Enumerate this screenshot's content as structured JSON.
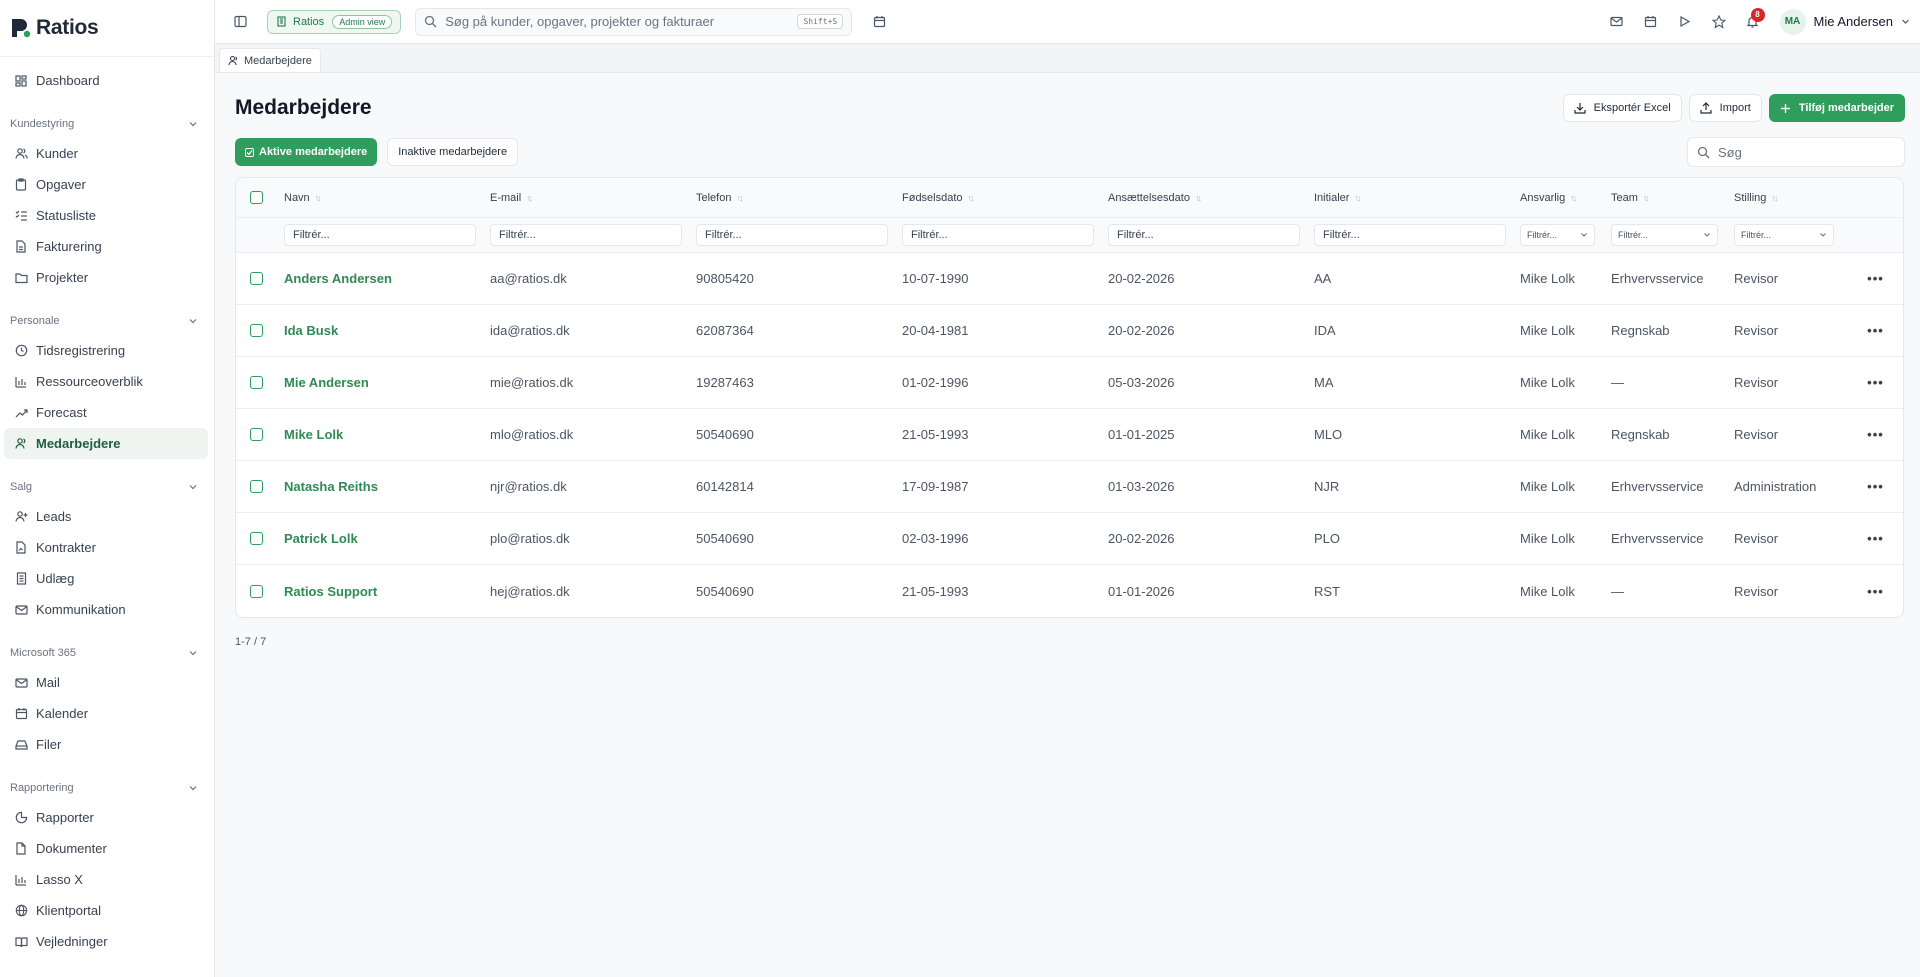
{
  "brand": {
    "name": "Ratios",
    "color": "#2f9e5c"
  },
  "sidebar": {
    "top": [
      {
        "label": "Dashboard",
        "icon": "dashboard-icon"
      }
    ],
    "sections": [
      {
        "title": "Kundestyring",
        "items": [
          {
            "label": "Kunder",
            "icon": "users-icon"
          },
          {
            "label": "Opgaver",
            "icon": "clipboard-icon"
          },
          {
            "label": "Statusliste",
            "icon": "list-check-icon"
          },
          {
            "label": "Fakturering",
            "icon": "file-text-icon"
          },
          {
            "label": "Projekter",
            "icon": "folder-icon"
          }
        ]
      },
      {
        "title": "Personale",
        "items": [
          {
            "label": "Tidsregistrering",
            "icon": "clock-icon"
          },
          {
            "label": "Ressourceoverblik",
            "icon": "bar-chart-icon"
          },
          {
            "label": "Forecast",
            "icon": "trending-up-icon"
          },
          {
            "label": "Medarbejdere",
            "icon": "user-icon",
            "active": true
          }
        ]
      },
      {
        "title": "Salg",
        "items": [
          {
            "label": "Leads",
            "icon": "user-plus-icon"
          },
          {
            "label": "Kontrakter",
            "icon": "file-signature-icon"
          },
          {
            "label": "Udlæg",
            "icon": "receipt-icon"
          },
          {
            "label": "Kommunikation",
            "icon": "mail-icon"
          }
        ]
      },
      {
        "title": "Microsoft 365",
        "items": [
          {
            "label": "Mail",
            "icon": "mail-icon"
          },
          {
            "label": "Kalender",
            "icon": "calendar-icon"
          },
          {
            "label": "Filer",
            "icon": "hard-drive-icon"
          }
        ]
      },
      {
        "title": "Rapportering",
        "items": [
          {
            "label": "Rapporter",
            "icon": "pie-chart-icon"
          },
          {
            "label": "Dokumenter",
            "icon": "file-icon"
          },
          {
            "label": "Lasso X",
            "icon": "bar-chart-icon"
          },
          {
            "label": "Klientportal",
            "icon": "globe-icon"
          },
          {
            "label": "Vejledninger",
            "icon": "book-icon"
          }
        ]
      }
    ]
  },
  "topbar": {
    "org_label": "Ratios",
    "org_badge": "Admin view",
    "search_placeholder": "Søg på kunder, opgaver, projekter og fakturaer",
    "search_shortcut": "Shift+S",
    "notification_count": "8",
    "user_initials": "MA",
    "user_name": "Mie Andersen"
  },
  "tab": {
    "label": "Medarbejdere"
  },
  "page": {
    "title": "Medarbejdere",
    "export_label": "Eksportér Excel",
    "import_label": "Import",
    "add_label": "Tilføj medarbejder",
    "filter_active": "Aktive medarbejdere",
    "filter_inactive": "Inaktive medarbejdere",
    "table_search_placeholder": "Søg",
    "pager": "1-7 / 7"
  },
  "table": {
    "columns": [
      "Navn",
      "E-mail",
      "Telefon",
      "Fødselsdato",
      "Ansættelsesdato",
      "Initialer",
      "Ansvarlig",
      "Team",
      "Stilling"
    ],
    "filter_placeholder": "Filtrér...",
    "filter_select_placeholder": "Filtrér...",
    "rows": [
      {
        "name": "Anders Andersen",
        "email": "aa@ratios.dk",
        "phone": "90805420",
        "birth": "10-07-1990",
        "hired": "20-02-2026",
        "initials": "AA",
        "responsible": "Mike Lolk",
        "team": "Erhvervsservice",
        "role": "Revisor"
      },
      {
        "name": "Ida Busk",
        "email": "ida@ratios.dk",
        "phone": "62087364",
        "birth": "20-04-1981",
        "hired": "20-02-2026",
        "initials": "IDA",
        "responsible": "Mike Lolk",
        "team": "Regnskab",
        "role": "Revisor"
      },
      {
        "name": "Mie Andersen",
        "email": "mie@ratios.dk",
        "phone": "19287463",
        "birth": "01-02-1996",
        "hired": "05-03-2026",
        "initials": "MA",
        "responsible": "Mike Lolk",
        "team": "—",
        "role": "Revisor"
      },
      {
        "name": "Mike Lolk",
        "email": "mlo@ratios.dk",
        "phone": "50540690",
        "birth": "21-05-1993",
        "hired": "01-01-2025",
        "initials": "MLO",
        "responsible": "Mike Lolk",
        "team": "Regnskab",
        "role": "Revisor"
      },
      {
        "name": "Natasha Reiths",
        "email": "njr@ratios.dk",
        "phone": "60142814",
        "birth": "17-09-1987",
        "hired": "01-03-2026",
        "initials": "NJR",
        "responsible": "Mike Lolk",
        "team": "Erhvervsservice",
        "role": "Administration"
      },
      {
        "name": "Patrick Lolk",
        "email": "plo@ratios.dk",
        "phone": "50540690",
        "birth": "02-03-1996",
        "hired": "20-02-2026",
        "initials": "PLO",
        "responsible": "Mike Lolk",
        "team": "Erhvervsservice",
        "role": "Revisor"
      },
      {
        "name": "Ratios Support",
        "email": "hej@ratios.dk",
        "phone": "50540690",
        "birth": "21-05-1993",
        "hired": "01-01-2026",
        "initials": "RST",
        "responsible": "Mike Lolk",
        "team": "—",
        "role": "Revisor"
      }
    ]
  }
}
